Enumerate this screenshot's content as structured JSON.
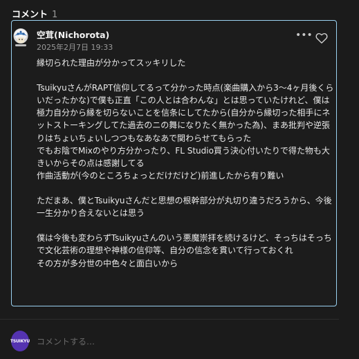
{
  "comments_section": {
    "title": "コメント",
    "count": "1"
  },
  "comment": {
    "author": "空茸(Nichorota)",
    "date": "2025年2月7日 19:33",
    "more_icon": "more-horizontal-icon",
    "like_icon": "heart-outline-icon",
    "lines": [
      "縁切られた理由が分かってスッキリした",
      "",
      "TsuikyuさんがRAPT信仰してるって分かった時点(楽曲購入から3〜4ヶ月後くらいだったかな)で僕も正直「この人とは合わんな」とは思っていたけれど、僕は極力自分から縁を切らないことを信条にしてたから(自分から縁切った相手にネットストーキングしてた過去のニの舞になりたく無かった為)、まあ批判や逆張りはちょいちょいしつつもなあなあで関わらせてもらった",
      "でもお陰でMixのやり方分かったり、FL Studio買う決心付いたりで得た物も大きいからその点は感謝してる",
      "作曲活動が(今のところちょっとだけだけど)前進したから有り難い",
      "",
      "ただまあ、僕とTsuikyuさんだと思想の根幹部分が丸切り違うだろうから、今後一生分かり合えないとは思う",
      "",
      "僕は今後も変わらずTsuikyuさんのいう悪魔崇拝を続けるけど、そっちはそっちで文化芸術の理想や神様の信仰等、自分の信念を貫いて行っておくれ",
      "その方が多分世の中色々と面白いから"
    ]
  },
  "reply": {
    "avatar_text": "TSUIKYU",
    "placeholder": "コメントする…",
    "value": ""
  },
  "colors": {
    "background": "#1b1b1b",
    "card_border": "#9bd3f2",
    "avatar_bg": "#5433b0"
  }
}
